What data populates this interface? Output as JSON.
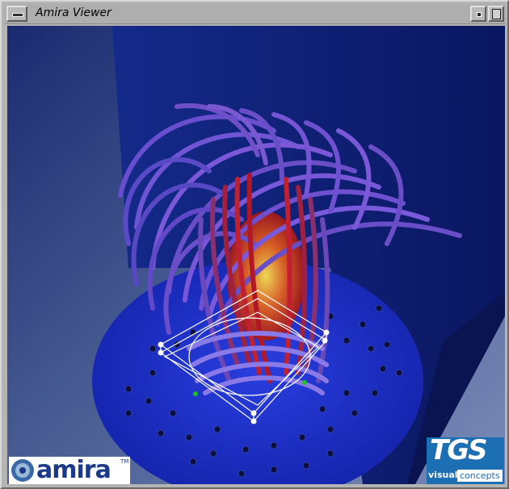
{
  "window": {
    "title": "Amira Viewer"
  },
  "titlebar_icons": {
    "menu": "window-menu-icon",
    "minimize": "minimize-icon",
    "maximize": "maximize-icon"
  },
  "logos": {
    "amira": {
      "text": "amira",
      "trademark": "TM"
    },
    "tgs": {
      "text": "TGS",
      "visual": "visual",
      "concepts": "concepts"
    }
  },
  "colors": {
    "background": "#5a6e9c",
    "platform": "#1a2ec8",
    "wall": "#0d1f8a",
    "stream_outer": "#7a55d0",
    "stream_inner": "#c02020",
    "core": "#f0d040",
    "handle_green": "#20c020"
  }
}
